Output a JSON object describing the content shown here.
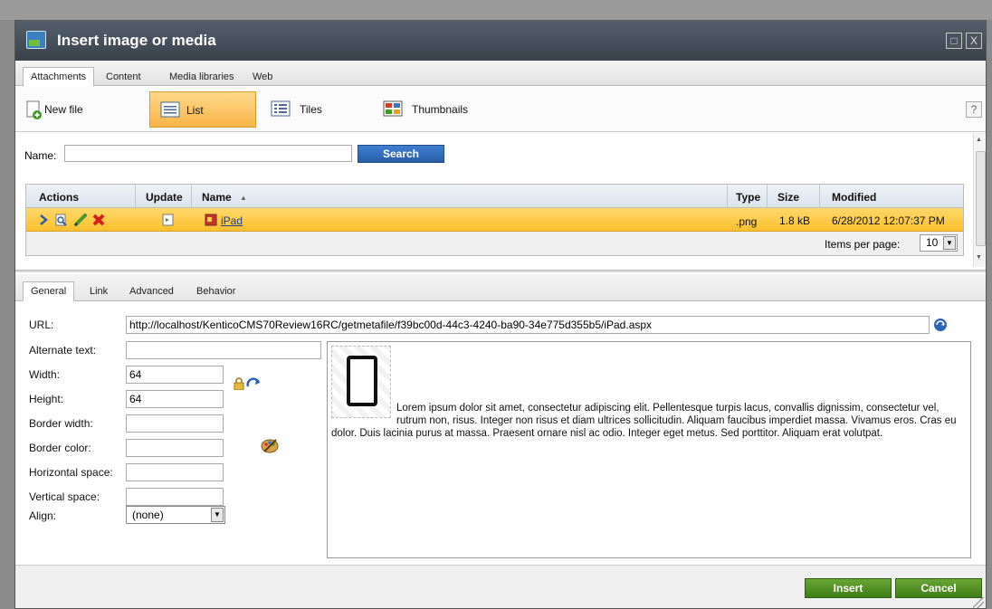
{
  "dialog": {
    "title": "Insert image or media",
    "maximize_label": "□",
    "close_label": "X"
  },
  "top_tabs": [
    {
      "label": "Attachments",
      "active": true
    },
    {
      "label": "Content",
      "active": false
    },
    {
      "label": "Media libraries",
      "active": false
    },
    {
      "label": "Web",
      "active": false
    }
  ],
  "toolbar": {
    "new_file": "New file",
    "list": "List",
    "tiles": "Tiles",
    "thumbnails": "Thumbnails",
    "help": "?"
  },
  "search": {
    "label": "Name:",
    "value": "",
    "button": "Search"
  },
  "grid": {
    "columns": [
      "Actions",
      "Update",
      "Name",
      "Type",
      "Size",
      "Modified"
    ],
    "sort_indicator": "▲",
    "rows": [
      {
        "name": "iPad",
        "type": ".png",
        "size": "1.8 kB",
        "modified": "6/28/2012 12:07:37 PM"
      }
    ],
    "items_per_page_label": "Items per page:",
    "items_per_page_value": "10"
  },
  "bottom_tabs": [
    {
      "label": "General",
      "active": true
    },
    {
      "label": "Link",
      "active": false
    },
    {
      "label": "Advanced",
      "active": false
    },
    {
      "label": "Behavior",
      "active": false
    }
  ],
  "properties": {
    "url_label": "URL:",
    "url_value": "http://localhost/KenticoCMS70Review16RC/getmetafile/f39bc00d-44c3-4240-ba90-34e775d355b5/iPad.aspx",
    "alt_label": "Alternate text:",
    "alt_value": "",
    "width_label": "Width:",
    "width_value": "64",
    "height_label": "Height:",
    "height_value": "64",
    "border_width_label": "Border width:",
    "border_width_value": "",
    "border_color_label": "Border color:",
    "border_color_value": "",
    "hspace_label": "Horizontal space:",
    "hspace_value": "",
    "vspace_label": "Vertical space:",
    "vspace_value": "",
    "align_label": "Align:",
    "align_value": "(none)"
  },
  "preview": {
    "text": "Lorem ipsum dolor sit amet, consectetur adipiscing elit. Pellentesque turpis lacus, convallis dignissim, consectetur vel, rutrum non, risus. Integer non risus et diam ultrices sollicitudin. Aliquam faucibus imperdiet massa. Vivamus eros. Cras eu dolor. Duis lacinia purus at massa. Praesent ornare nisl ac odio. Integer eget metus. Sed porttitor. Aliquam erat volutpat."
  },
  "buttons": {
    "insert": "Insert",
    "cancel": "Cancel"
  },
  "colors": {
    "title_bar": "#3f4953",
    "selected_row": "#fbc93d",
    "search_button": "#2f68b5",
    "action_button": "#4e9126"
  }
}
